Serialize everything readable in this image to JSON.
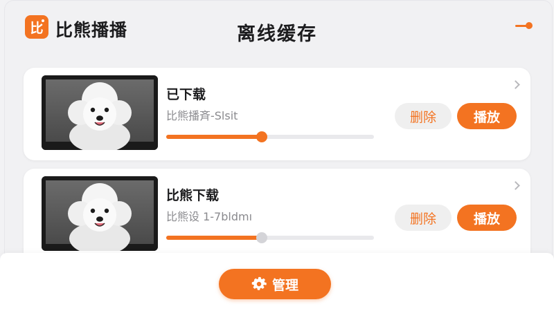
{
  "header": {
    "logo_glyph": "比",
    "brand_name": "比熊播播",
    "title": "离线缓存",
    "menu_icon": "slider-toggle-icon"
  },
  "downloads": [
    {
      "title": "已下载",
      "subtitle": "比熊播斉-Slsit",
      "progress": 0.46,
      "progress_knob_color": "#f37321",
      "delete_label": "删除",
      "play_label": "播放",
      "thumbnail": "white-bichon-dog-photo"
    },
    {
      "title": "比熊下载",
      "subtitle": "比熊设 1-7bldmı",
      "progress": 0.46,
      "progress_knob_color": "#d4d4d8",
      "delete_label": "删除",
      "play_label": "播放",
      "thumbnail": "white-bichon-dog-photo"
    }
  ],
  "bottom": {
    "manage_label": "管理",
    "manage_icon": "gear-icon"
  },
  "colors": {
    "accent": "#f37321",
    "background": "#f2f2f4",
    "card": "#ffffff"
  }
}
